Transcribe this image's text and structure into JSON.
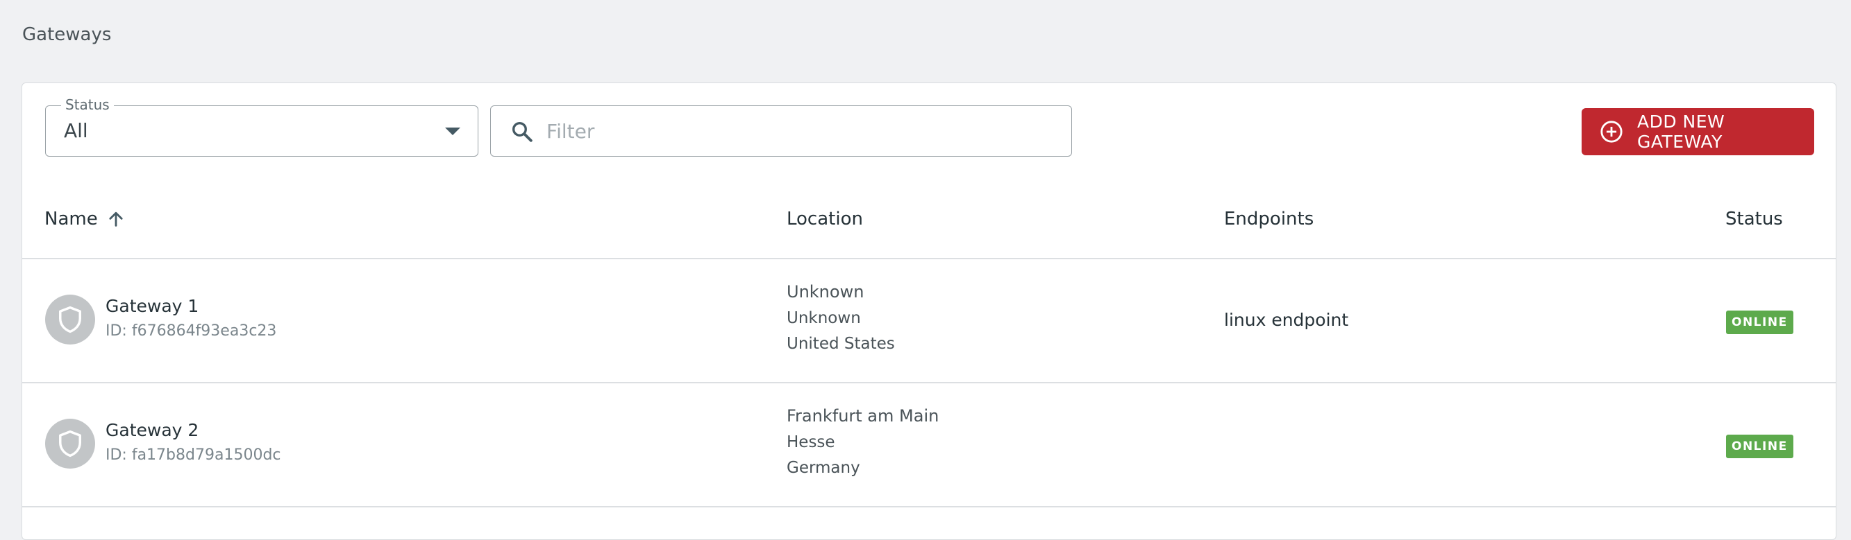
{
  "page": {
    "title": "Gateways"
  },
  "toolbar": {
    "status_label": "Status",
    "status_value": "All",
    "filter_placeholder": "Filter",
    "add_button_label": "ADD NEW GATEWAY",
    "accent_color": "#c0282f"
  },
  "table": {
    "columns": {
      "name": "Name",
      "location": "Location",
      "endpoints": "Endpoints",
      "status": "Status"
    },
    "sort": "name-ascending",
    "rows": [
      {
        "name": "Gateway 1",
        "id": "ID: f676864f93ea3c23",
        "location": [
          "Unknown",
          "Unknown",
          "United States"
        ],
        "endpoints": "linux endpoint",
        "status": "ONLINE"
      },
      {
        "name": "Gateway 2",
        "id": "ID: fa17b8d79a1500dc",
        "location": [
          "Frankfurt am Main",
          "Hesse",
          "Germany"
        ],
        "endpoints": "",
        "status": "ONLINE"
      }
    ],
    "status_color": "#5daa4c"
  },
  "icons": {
    "search": "search-icon",
    "add": "add-circle-icon",
    "sort": "arrow-up-icon",
    "caret": "caret-down-icon",
    "avatar": "shield-icon"
  }
}
